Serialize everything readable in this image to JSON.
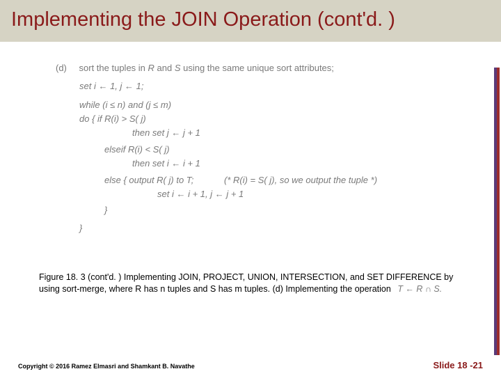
{
  "title": "Implementing the JOIN Operation (cont'd. )",
  "algorithm": {
    "tag": "(d)",
    "line1_a": "sort the tuples in ",
    "line1_R": "R",
    "line1_b": " and ",
    "line1_S": "S",
    "line1_c": " using the same unique sort attributes;",
    "line2": "set i ← 1, j ← 1;",
    "line3": "while (i ≤ n) and (j ≤ m)",
    "line4": "do  {    if R(i) > S( j)",
    "line5": "then set j ← j + 1",
    "line6": "elseif R(i) < S( j)",
    "line7": "then set i ← i + 1",
    "line8a": "else  {    output ",
    "line8b": "R( j)",
    "line8c": " to ",
    "line8d": "T;",
    "line8_comment": "(* R(i) = S( j), so we output the tuple *)",
    "line9": "set i ← i + 1, j ← j + 1",
    "line10": "}",
    "line11": "}"
  },
  "caption": "Figure 18. 3 (cont'd. ) Implementing JOIN, PROJECT, UNION, INTERSECTION, and SET DIFFERENCE by using sort-merge, where R has n tuples and S has m tuples. (d) Implementing the operation",
  "formula": "T ← R ∩ S.",
  "copyright": "Copyright © 2016 Ramez Elmasri and Shamkant B. Navathe",
  "slide": "Slide 18 -21"
}
